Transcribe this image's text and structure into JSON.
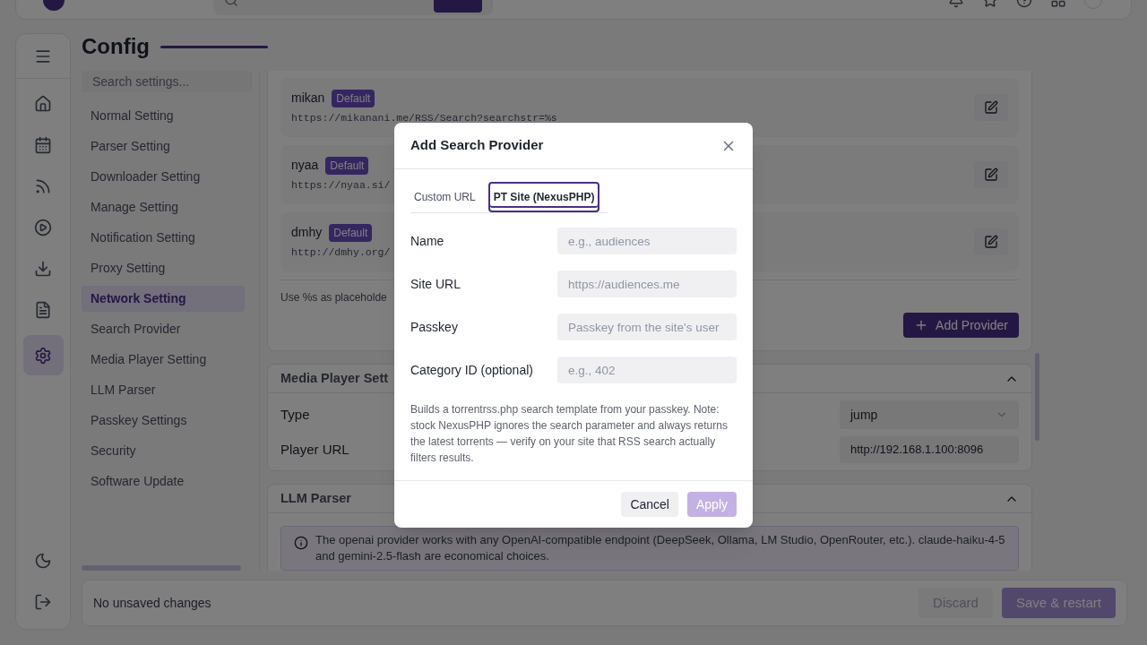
{
  "rail": {
    "items": [
      {
        "kind": "home",
        "selected": false
      },
      {
        "kind": "calendar",
        "selected": false
      },
      {
        "kind": "rss",
        "selected": false
      },
      {
        "kind": "player",
        "selected": false
      },
      {
        "kind": "download",
        "selected": false
      },
      {
        "kind": "log",
        "selected": false
      },
      {
        "kind": "config",
        "selected": true
      }
    ]
  },
  "page": {
    "title": "Config"
  },
  "settings_nav": {
    "search_placeholder": "Search settings...",
    "items": [
      {
        "label": "Normal Setting",
        "selected": false
      },
      {
        "label": "Parser Setting",
        "selected": false
      },
      {
        "label": "Downloader Setting",
        "selected": false
      },
      {
        "label": "Manage Setting",
        "selected": false
      },
      {
        "label": "Notification Setting",
        "selected": false
      },
      {
        "label": "Proxy Setting",
        "selected": false
      },
      {
        "label": "Network Setting",
        "selected": true
      },
      {
        "label": "Search Provider",
        "selected": false
      },
      {
        "label": "Media Player Setting",
        "selected": false
      },
      {
        "label": "LLM Parser",
        "selected": false
      },
      {
        "label": "Passkey Settings",
        "selected": false
      },
      {
        "label": "Security",
        "selected": false
      },
      {
        "label": "Software Update",
        "selected": false
      }
    ]
  },
  "providers": [
    {
      "name": "mikan",
      "badge": "Default",
      "url": "https://mikanani.me/RSS/Search?searchstr=%s"
    },
    {
      "name": "nyaa",
      "badge": "Default",
      "url": "https://nyaa.si/"
    },
    {
      "name": "dmhy",
      "badge": "Default",
      "url": "http://dmhy.org/"
    }
  ],
  "provider_hint": "Use %s as placeholde",
  "add_button": "Add Provider",
  "media_player": {
    "title": "Media Player Sett",
    "expanded": true,
    "fields": [
      {
        "label": "Type",
        "kind": "select",
        "value": "jump"
      },
      {
        "label": "Player URL",
        "kind": "text",
        "value": "http://192.168.1.100:8096"
      }
    ]
  },
  "llm_parser": {
    "title": "LLM Parser",
    "expanded": true,
    "info": "The openai provider works with any OpenAI-compatible endpoint (DeepSeek, Ollama, LM Studio, OpenRouter, etc.). claude-haiku-4-5 and gemini-2.5-flash are economical choices."
  },
  "footer": {
    "status": "No unsaved changes",
    "discard": {
      "label": "Discard",
      "disabled": true
    },
    "save": {
      "label": "Save & restart",
      "disabled": true
    }
  },
  "dialog": {
    "title": "Add Search Provider",
    "tabs": [
      {
        "label": "Custom URL",
        "selected": false
      },
      {
        "label": "PT Site (NexusPHP)",
        "selected": true
      }
    ],
    "fields": [
      {
        "label": "Name",
        "placeholder": "e.g., audiences"
      },
      {
        "label": "Site URL",
        "placeholder": "https://audiences.me"
      },
      {
        "label": "Passkey",
        "placeholder": "Passkey from the site's user"
      },
      {
        "label": "Category ID (optional)",
        "placeholder": "e.g., 402"
      }
    ],
    "help": "Builds a torrentrss.php search template from your passkey. Note: stock NexusPHP ignores the search parameter and always returns the latest torrents — verify on your site that RSS search actually filters results.",
    "cancel": "Cancel",
    "apply": {
      "label": "Apply",
      "disabled": true
    }
  }
}
